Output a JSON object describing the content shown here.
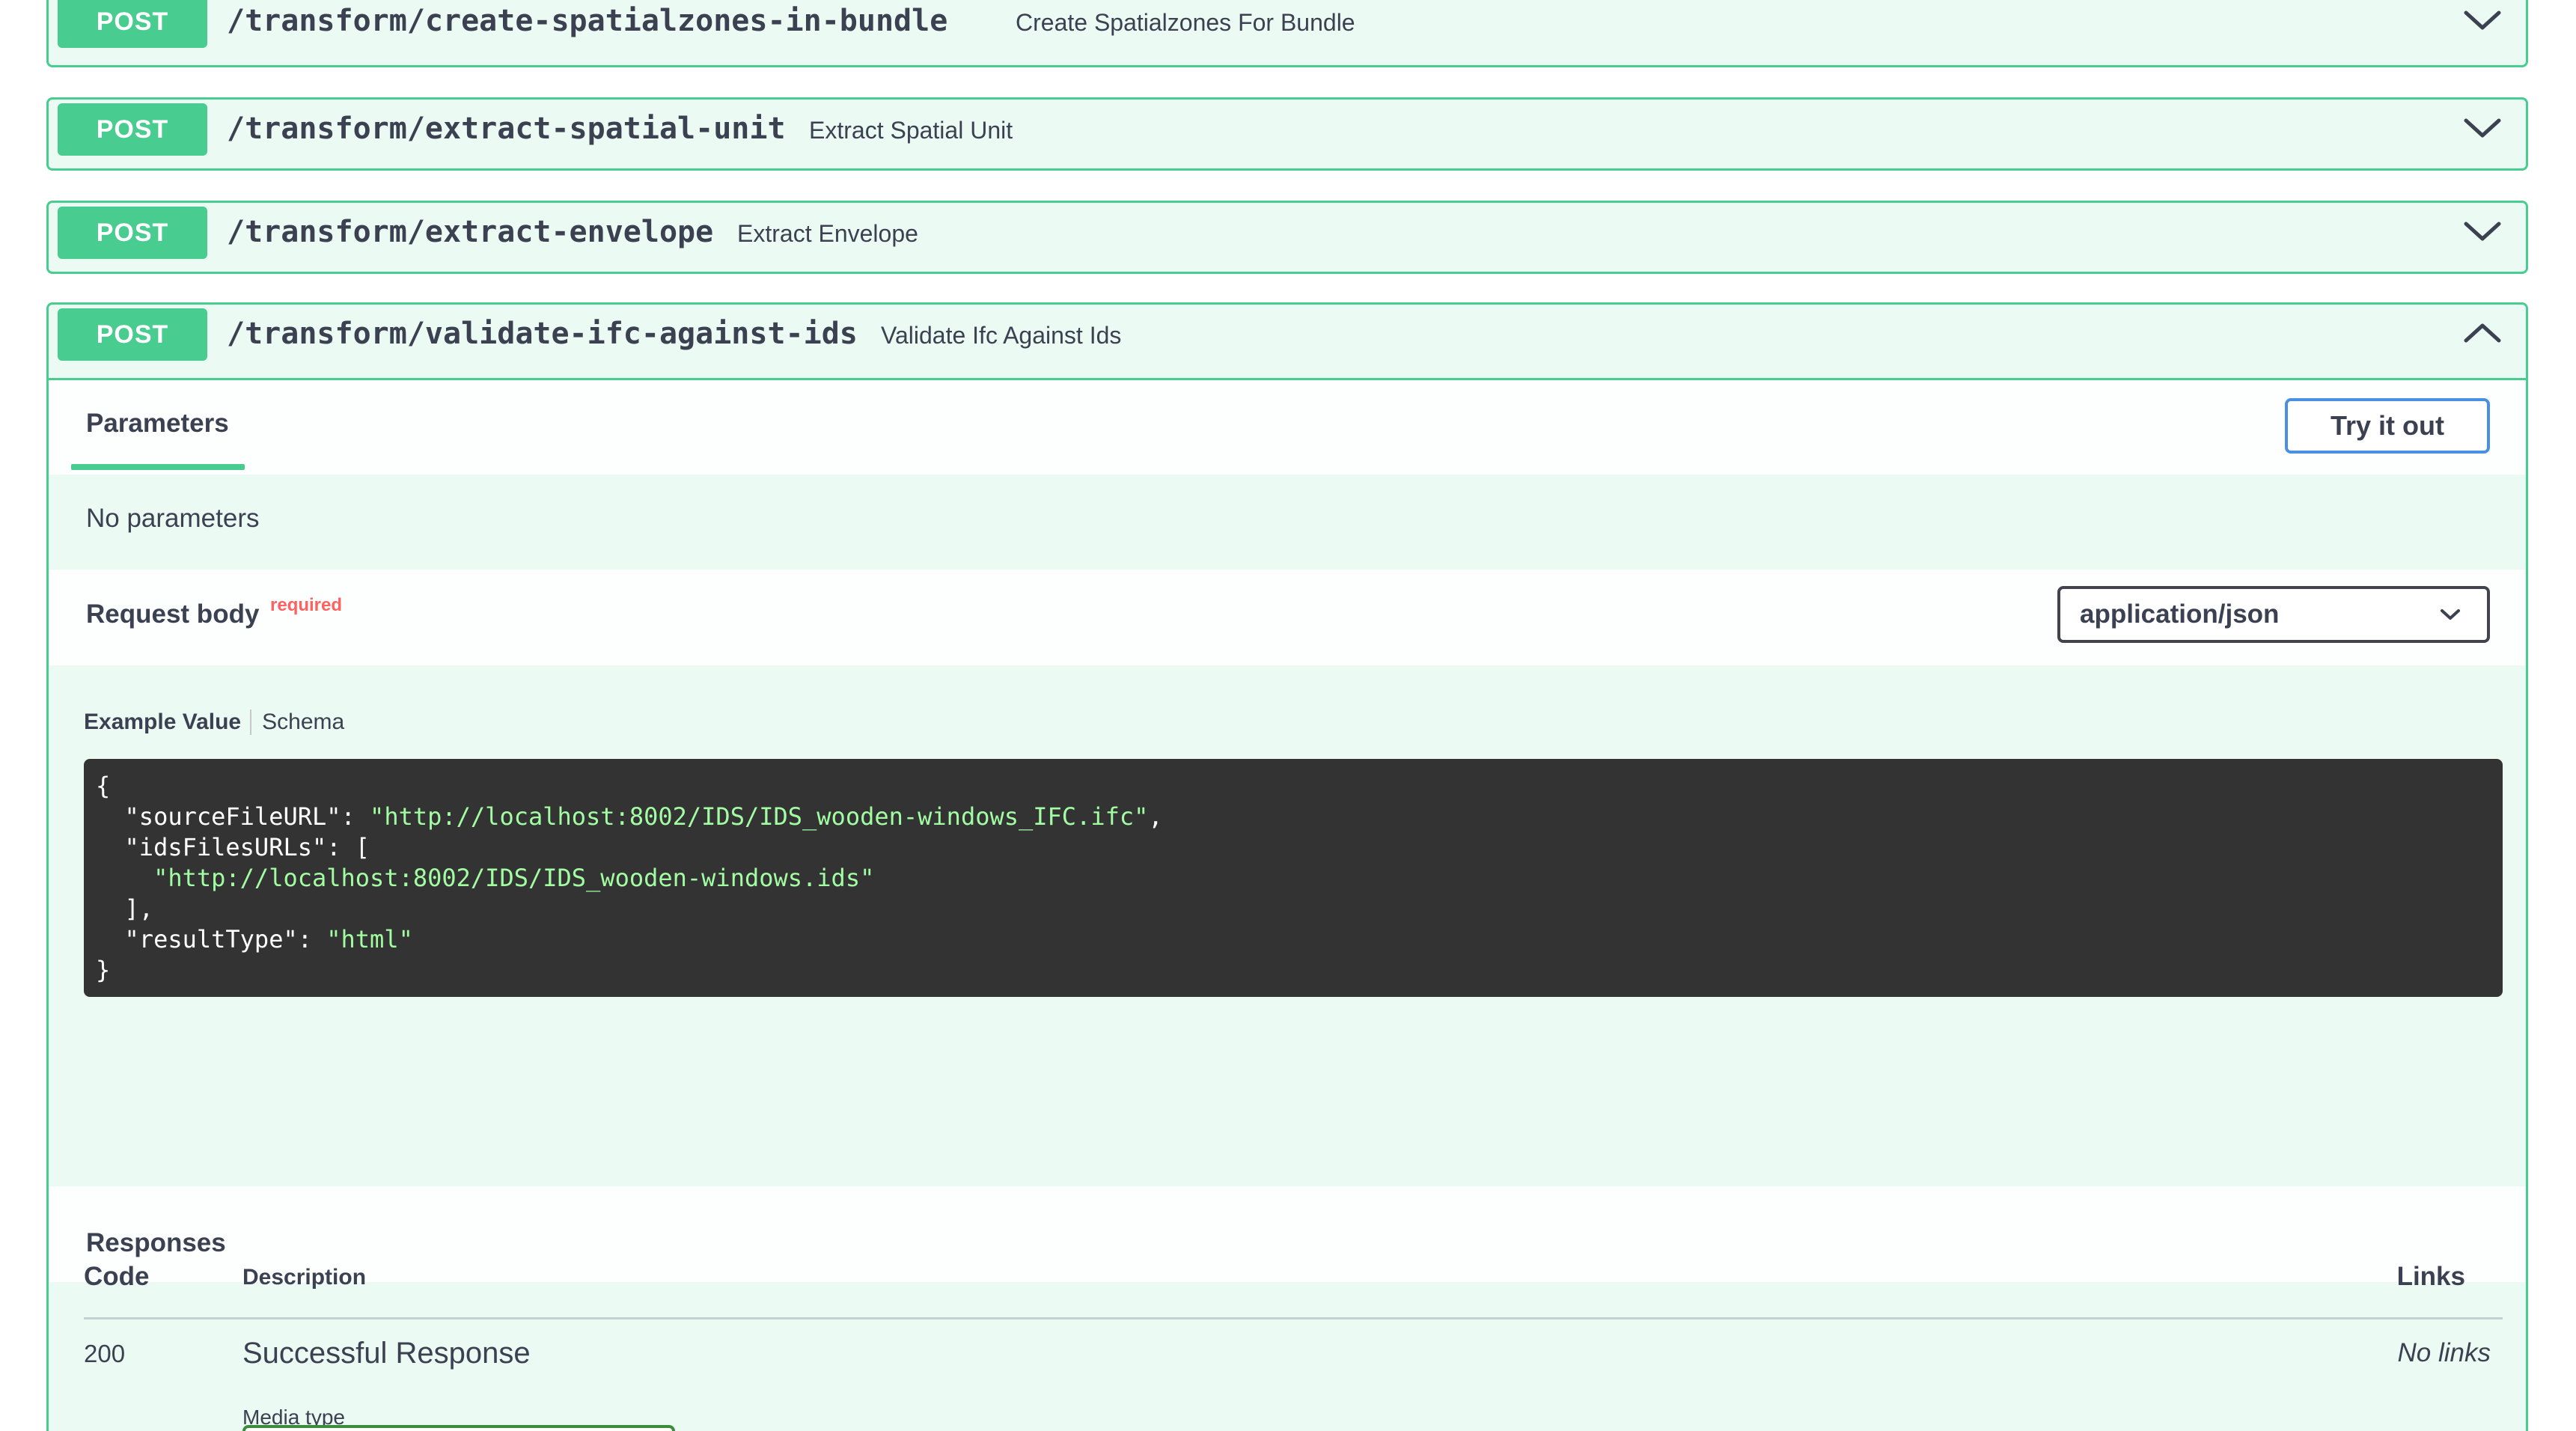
{
  "operations": [
    {
      "method": "POST",
      "path": "/transform/create-spatialzones-in-bundle",
      "summary": "Create Spatialzones For Bundle",
      "expanded": false
    },
    {
      "method": "POST",
      "path": "/transform/extract-spatial-unit",
      "summary": "Extract Spatial Unit",
      "expanded": false
    },
    {
      "method": "POST",
      "path": "/transform/extract-envelope",
      "summary": "Extract Envelope",
      "expanded": false
    },
    {
      "method": "POST",
      "path": "/transform/validate-ifc-against-ids",
      "summary": "Validate Ifc Against Ids",
      "expanded": true
    }
  ],
  "expanded_op": {
    "parameters_tab": "Parameters",
    "try_button": "Try it out",
    "no_parameters": "No parameters",
    "request_body_title": "Request body",
    "required_label": "required",
    "content_type": "application/json",
    "example_tab": "Example Value",
    "schema_tab": "Schema",
    "example_lines": [
      {
        "plain_before": "{",
        "string": "",
        "plain_after": ""
      },
      {
        "plain_before": "  \"sourceFileURL\": ",
        "string": "\"http://localhost:8002/IDS/IDS_wooden-windows_IFC.ifc\"",
        "plain_after": ","
      },
      {
        "plain_before": "  \"idsFilesURLs\": [",
        "string": "",
        "plain_after": ""
      },
      {
        "plain_before": "    ",
        "string": "\"http://localhost:8002/IDS/IDS_wooden-windows.ids\"",
        "plain_after": ""
      },
      {
        "plain_before": "  ],",
        "string": "",
        "plain_after": ""
      },
      {
        "plain_before": "  \"resultType\": ",
        "string": "\"html\"",
        "plain_after": ""
      },
      {
        "plain_before": "}",
        "string": "",
        "plain_after": ""
      }
    ],
    "responses_title": "Responses",
    "responses_table": {
      "headers": {
        "code": "Code",
        "description": "Description",
        "links": "Links"
      },
      "rows": [
        {
          "code": "200",
          "description": "Successful Response",
          "links": "No links",
          "media_type_label": "Media type"
        }
      ]
    }
  },
  "colors": {
    "post_green": "#49cc90",
    "text": "#3b4151",
    "try_button_border": "#4990e2",
    "required_red": "#ff6060",
    "code_bg": "#333333",
    "code_string": "#a2fca2"
  },
  "icons": {
    "collapsed": "chevron-down-icon",
    "expanded": "chevron-up-icon",
    "select_caret": "caret-down-icon"
  }
}
